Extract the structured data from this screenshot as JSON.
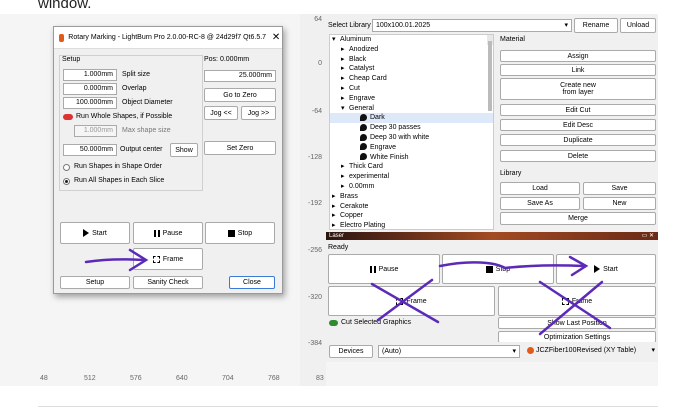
{
  "caption": "window.",
  "ruler": {
    "left_values": [
      "64",
      "0",
      "-64",
      "-128",
      "-192",
      "-256",
      "-320",
      "-384"
    ],
    "bottom_values": [
      "48",
      "512",
      "576",
      "640",
      "704",
      "768",
      "83"
    ]
  },
  "dialog": {
    "title": "Rotary Marking - LightBurn Pro 2.0.00-RC-8 @ 24d29f7 Qt6.5.7",
    "close_glyph": "✕",
    "setup_header": "Setup",
    "split_size": {
      "value": "1.000mm",
      "label": "Split size"
    },
    "overlap": {
      "value": "0.000mm",
      "label": "Overlap"
    },
    "object_diameter": {
      "value": "100.000mm",
      "label": "Object Diameter"
    },
    "run_whole_label": "Run Whole Shapes, if Possible",
    "max_shape_size": {
      "value": "1.000mm",
      "label": "Max shape size"
    },
    "output_center": {
      "value": "50.000mm",
      "label": "Output center"
    },
    "show_label": "Show",
    "run_shape_order": "Run Shapes in Shape Order",
    "run_all_shapes": "Run All Shapes in Each Slice",
    "pos_label": "Pos: 0.000mm",
    "pos_value": "25.000mm",
    "go_to_zero": "Go to Zero",
    "jog_left": "Jog <<",
    "jog_right": "Jog >>",
    "set_zero": "Set Zero",
    "start": "Start",
    "pause": "Pause",
    "stop": "Stop",
    "frame": "Frame",
    "setup_btn": "Setup",
    "sanity_check": "Sanity Check",
    "close_btn": "Close"
  },
  "library": {
    "select_label": "Select Library",
    "library_value": "100x100.01.2025",
    "rename": "Rename",
    "unload": "Unload",
    "tree": [
      {
        "text": "Aluminum",
        "indent": 0,
        "arrow": "▾",
        "leaf": false
      },
      {
        "text": "Anodized",
        "indent": 1,
        "arrow": "▸",
        "leaf": false
      },
      {
        "text": "Black",
        "indent": 1,
        "arrow": "▸",
        "leaf": false
      },
      {
        "text": "Catalyst",
        "indent": 1,
        "arrow": "▸",
        "leaf": false
      },
      {
        "text": "Cheap Card",
        "indent": 1,
        "arrow": "▸",
        "leaf": false
      },
      {
        "text": "Cut",
        "indent": 1,
        "arrow": "▸",
        "leaf": false
      },
      {
        "text": "Engrave",
        "indent": 1,
        "arrow": "▸",
        "leaf": false
      },
      {
        "text": "General",
        "indent": 1,
        "arrow": "▾",
        "leaf": false
      },
      {
        "text": "Dark",
        "indent": 2,
        "arrow": "",
        "leaf": true,
        "selected": true
      },
      {
        "text": "Deep 30 passes",
        "indent": 2,
        "arrow": "",
        "leaf": true
      },
      {
        "text": "Deep 30 with white",
        "indent": 2,
        "arrow": "",
        "leaf": true
      },
      {
        "text": "Engrave",
        "indent": 2,
        "arrow": "",
        "leaf": true
      },
      {
        "text": "White Finish",
        "indent": 2,
        "arrow": "",
        "leaf": true
      },
      {
        "text": "Thick Card",
        "indent": 1,
        "arrow": "▸",
        "leaf": false
      },
      {
        "text": "experimental",
        "indent": 1,
        "arrow": "▸",
        "leaf": false
      },
      {
        "text": "0.00mm",
        "indent": 1,
        "arrow": "▸",
        "leaf": false
      },
      {
        "text": "Brass",
        "indent": 0,
        "arrow": "▸",
        "leaf": false
      },
      {
        "text": "Cerakote",
        "indent": 0,
        "arrow": "▸",
        "leaf": false
      },
      {
        "text": "Copper",
        "indent": 0,
        "arrow": "▸",
        "leaf": false
      },
      {
        "text": "Electro Plating",
        "indent": 0,
        "arrow": "▸",
        "leaf": false
      }
    ],
    "material_header": "Material",
    "assign": "Assign",
    "link": "Link",
    "create_new_1": "Create new",
    "create_new_2": "from layer",
    "edit_cut": "Edit Cut",
    "edit_desc": "Edit Desc",
    "duplicate": "Duplicate",
    "delete": "Delete",
    "library_header": "Library",
    "load": "Load",
    "save": "Save",
    "save_as": "Save As",
    "new": "New",
    "merge": "Merge"
  },
  "laser": {
    "title": "Laser",
    "controls": "▭ ✕",
    "status": "Ready",
    "pause": "Pause",
    "stop": "Stop",
    "start": "Start",
    "frame1": "Frame",
    "frame2": "Frame",
    "cut_selected": "Cut Selected Graphics",
    "show_last": "Show Last Position",
    "optimization": "Optimization Settings",
    "devices": "Devices",
    "port": "(Auto)",
    "device_name": "JCZFiber100Revised (XY Table)"
  },
  "colors": {
    "annotation": "#5b2bb8",
    "accent": "#3b7ad9"
  }
}
